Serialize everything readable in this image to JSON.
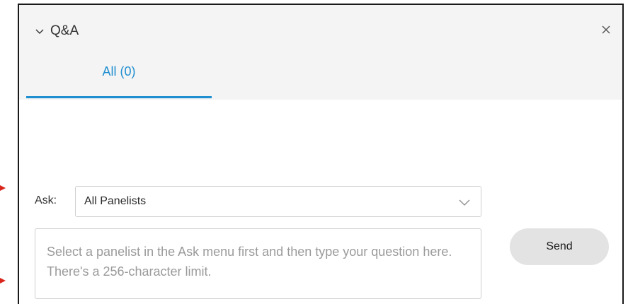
{
  "panel": {
    "title": "Q&A",
    "collapse_icon": "chevron-down-icon",
    "close_icon": "close-icon"
  },
  "tabs": [
    {
      "label": "All (0)",
      "active": true
    }
  ],
  "ask": {
    "label": "Ask:",
    "selected": "All Panelists",
    "dropdown_icon": "chevron-down-icon"
  },
  "question": {
    "placeholder": "Select a panelist in the Ask menu first and then type your question here. There's a 256-character limit.",
    "value": ""
  },
  "send": {
    "label": "Send"
  },
  "colors": {
    "accent": "#1f8fd0",
    "header_bg": "#f4f4f4",
    "annotation_arrow": "#d9261c",
    "send_bg": "#e3e3e3"
  }
}
